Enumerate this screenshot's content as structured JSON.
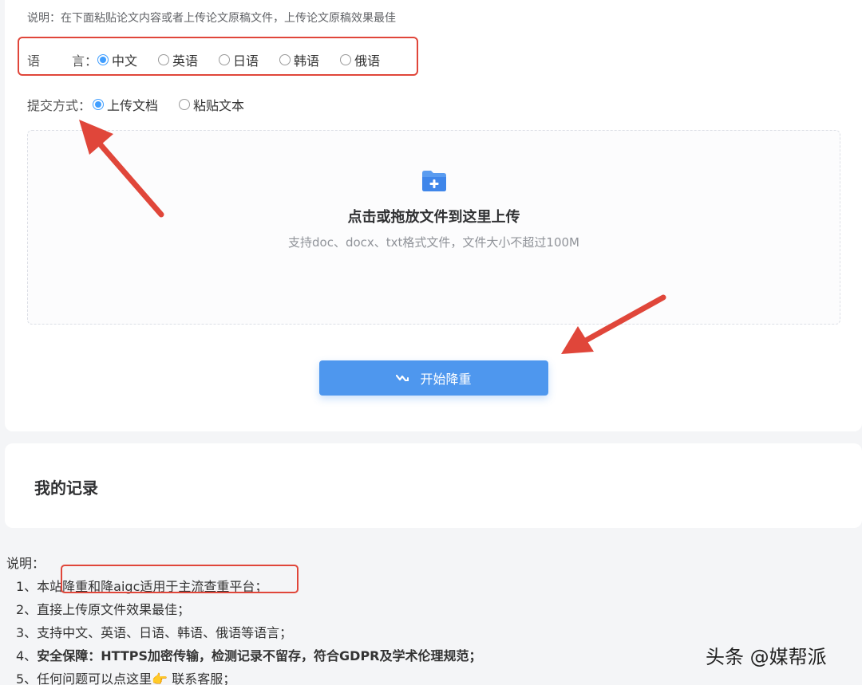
{
  "top_desc": "说明：在下面粘贴论文内容或者上传论文原稿文件，上传论文原稿效果最佳",
  "language": {
    "label_a": "语",
    "label_b": "言：",
    "options": [
      "中文",
      "英语",
      "日语",
      "韩语",
      "俄语"
    ],
    "selected": "中文"
  },
  "submit_mode": {
    "label": "提交方式：",
    "options": [
      "上传文档",
      "粘贴文本"
    ],
    "selected": "上传文档"
  },
  "upload": {
    "icon": "folder-plus-icon",
    "title": "点击或拖放文件到这里上传",
    "hint": "支持doc、docx、txt格式文件，文件大小不超过100M"
  },
  "start_button": {
    "label": "开始降重",
    "icon": "wave-icon"
  },
  "records": {
    "title": "我的记录"
  },
  "notes": {
    "heading": "说明：",
    "item1": "1、本站降重和降aigc适用于主流查重平台；",
    "item2": "2、直接上传原文件效果最佳；",
    "item3": "3、支持中文、英语、日语、韩语、俄语等语言；",
    "item4_prefix": "4、",
    "item4_bold": "安全保障：HTTPS加密传输，检测记录不留存，符合GDPR及学术伦理规范；",
    "item5_text": "5、任何问题可以点这里",
    "item5_emoji": "👉",
    "item5_link": " 联系客服；"
  },
  "watermark": "头条 @媒帮派",
  "colors": {
    "primary": "#409eff",
    "button": "#4e97ee",
    "annotation": "#e0463a"
  }
}
